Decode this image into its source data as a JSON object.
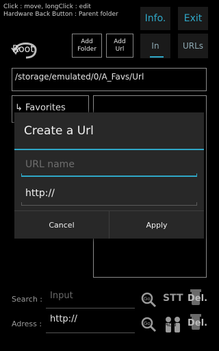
{
  "hints": {
    "line1": "Click : move, longClick : edit",
    "line2": "Hardware Back Button : Parent folder"
  },
  "top_buttons": {
    "info": "Info.",
    "exit": "Exit"
  },
  "root_label": "Root",
  "toolbar": {
    "add_folder": [
      "Add",
      "Folder"
    ],
    "add_url": [
      "Add",
      "Url"
    ]
  },
  "tabs": {
    "in": "In",
    "urls": "URLs"
  },
  "path": "/storage/emulated/0/A_Favs/Url",
  "favorites_label": "↳ Favorites",
  "search": {
    "label": "Search :",
    "placeholder": "Input",
    "go": "Go",
    "stt": "STT",
    "del": "Del."
  },
  "address": {
    "label": "Adress :",
    "value": "http://",
    "go": "Go",
    "add": "Add",
    "del": "Del."
  },
  "dialog": {
    "title": "Create a Url",
    "name_placeholder": "URL name",
    "url_value": "http://",
    "cancel": "Cancel",
    "apply": "Apply"
  },
  "colors": {
    "accent": "#2fa8c8",
    "background": "#000000",
    "dialog": "#282828"
  }
}
